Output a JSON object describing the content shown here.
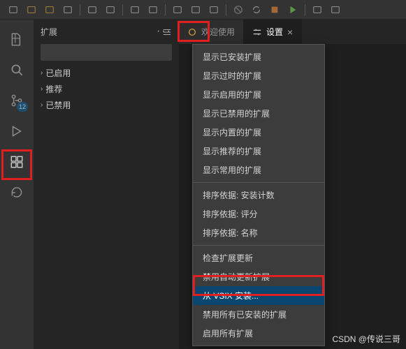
{
  "toolbar_icons": [
    "new-file",
    "open-folder",
    "open-project",
    "save",
    "save-all",
    "back",
    "forward",
    "split",
    "diff",
    "brush",
    "broom",
    "disable",
    "sync",
    "stop",
    "play",
    "debug",
    "terminal"
  ],
  "activity": {
    "items": [
      {
        "name": "files-icon"
      },
      {
        "name": "search-icon"
      },
      {
        "name": "source-control-icon",
        "badge": "12"
      },
      {
        "name": "run-icon"
      },
      {
        "name": "extensions-icon",
        "active": true
      },
      {
        "name": "refresh-icon"
      }
    ]
  },
  "ext_panel": {
    "title": "扩展",
    "tree": [
      {
        "label": "已启用"
      },
      {
        "label": "推荐"
      },
      {
        "label": "已禁用"
      }
    ]
  },
  "tabs": [
    {
      "label": "欢迎使用",
      "icon": "welcome-icon"
    },
    {
      "label": "设置",
      "icon": "settings-icon",
      "active": true
    }
  ],
  "menu": {
    "groups": [
      [
        "显示已安装扩展",
        "显示过时的扩展",
        "显示启用的扩展",
        "显示已禁用的扩展",
        "显示内置的扩展",
        "显示推荐的扩展",
        "显示常用的扩展"
      ],
      [
        "排序依据: 安装计数",
        "排序依据: 评分",
        "排序依据: 名称"
      ],
      [
        "检查扩展更新",
        "禁用自动更新扩展",
        "从 VSIX 安装...",
        "禁用所有已安装的扩展",
        "启用所有扩展"
      ]
    ],
    "selected": "从 VSIX 安装..."
  },
  "watermark": "CSDN @传说三哥"
}
